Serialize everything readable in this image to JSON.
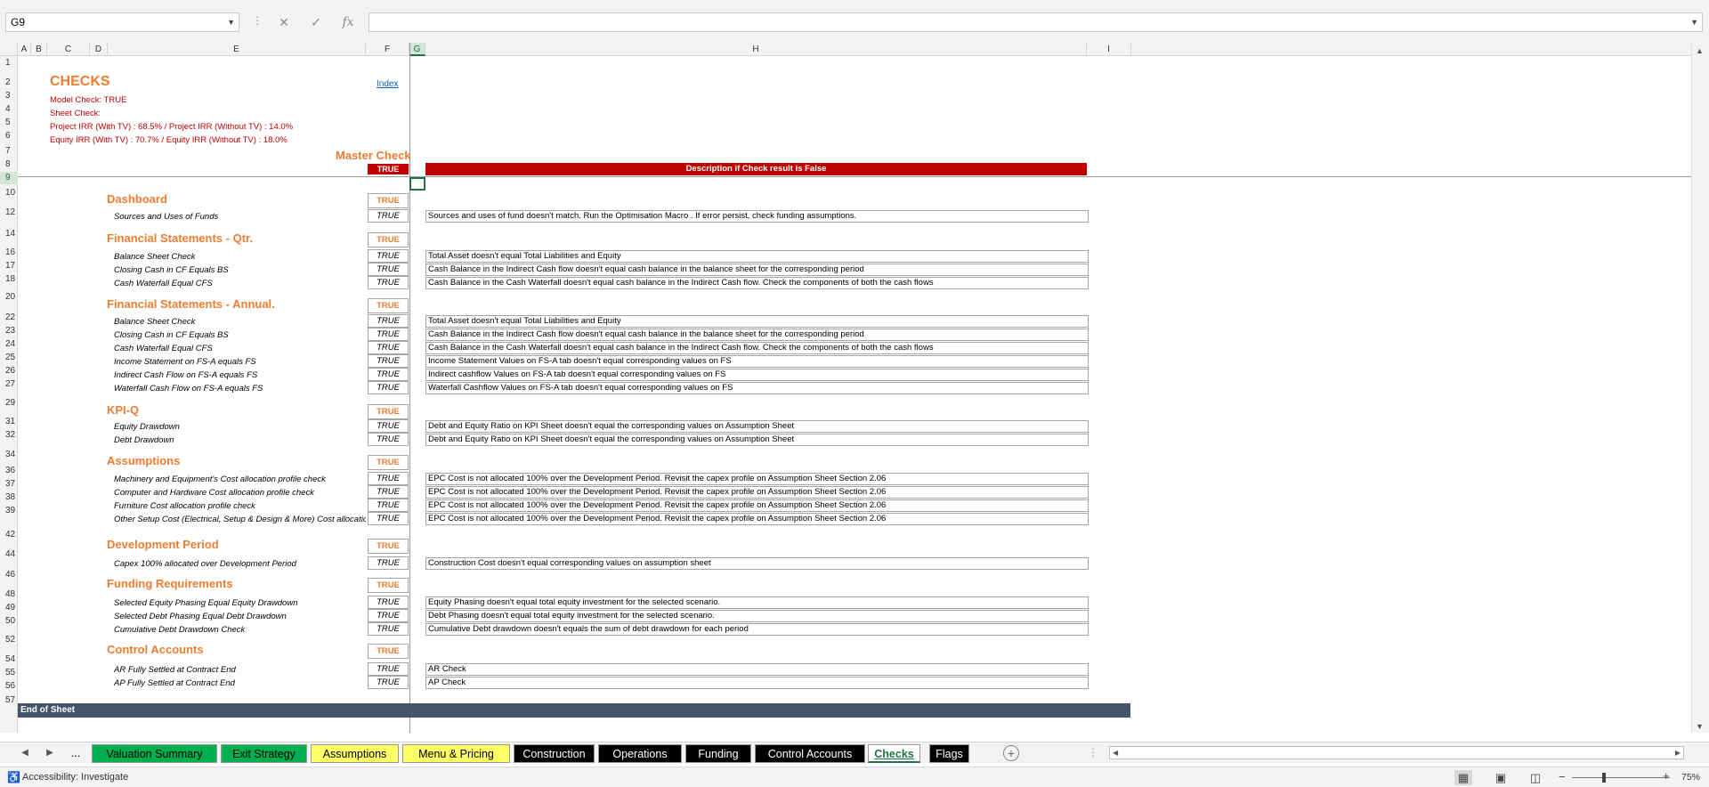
{
  "formula": {
    "name_box": "G9",
    "cancel_symbol": "✕",
    "enter_symbol": "✓",
    "fx_symbol": "fx",
    "formula_value": ""
  },
  "columns": [
    "A",
    "B",
    "C",
    "D",
    "E",
    "F",
    "G",
    "H",
    "I"
  ],
  "rows": [
    "1",
    "2",
    "3",
    "4",
    "5",
    "6",
    "7",
    "8",
    "9",
    "10",
    "12",
    "14",
    "16",
    "17",
    "18",
    "20",
    "22",
    "23",
    "24",
    "25",
    "26",
    "27",
    "29",
    "31",
    "32",
    "34",
    "36",
    "37",
    "38",
    "39",
    "42",
    "44",
    "46",
    "48",
    "49",
    "50",
    "52",
    "54",
    "55",
    "56",
    "57"
  ],
  "sheet": {
    "title": "CHECKS",
    "index_link": "Index",
    "model_check": "Model Check: TRUE",
    "sheet_check": "Sheet Check:",
    "project_irr": "Project IRR  (With TV) : 68.5%  / Project IRR (Without TV) : 14.0%",
    "equity_irr": "Equity IRR  (With TV) : 70.7%  / Equity IRR (Without TV) : 18.0%",
    "master_check_label": "Master Check",
    "master_check_value": "TRUE",
    "desc_header": "Description if Check result is False",
    "end_label": "End of Sheet"
  },
  "sections": [
    {
      "name": "Dashboard",
      "value": "TRUE",
      "items": [
        {
          "label": "Sources and Uses of Funds",
          "value": "TRUE",
          "desc": "Sources and uses of fund doesn't match. Run the Optimisation Macro . If error persist, check funding assumptions."
        }
      ]
    },
    {
      "name": "Financial Statements - Qtr.",
      "value": "TRUE",
      "items": [
        {
          "label": "Balance Sheet Check",
          "value": "TRUE",
          "desc": "Total Asset doesn't equal Total Liabilities and Equity"
        },
        {
          "label": "Closing Cash in CF Equals BS",
          "value": "TRUE",
          "desc": "Cash Balance in the Indirect Cash flow doesn't equal cash balance in the balance sheet for the corresponding period"
        },
        {
          "label": "Cash Waterfall Equal CFS",
          "value": "TRUE",
          "desc": "Cash Balance in the Cash Waterfall doesn't equal cash balance in the Indirect Cash flow. Check the components of both the cash flows"
        }
      ]
    },
    {
      "name": "Financial Statements - Annual.",
      "value": "TRUE",
      "items": [
        {
          "label": "Balance Sheet Check",
          "value": "TRUE",
          "desc": "Total Asset doesn't equal Total Liabilities and Equity"
        },
        {
          "label": "Closing Cash in CF Equals BS",
          "value": "TRUE",
          "desc": "Cash Balance in the Indirect Cash flow doesn't equal cash balance in the balance sheet for the corresponding period"
        },
        {
          "label": "Cash Waterfall Equal CFS",
          "value": "TRUE",
          "desc": "Cash Balance in the Cash Waterfall doesn't equal cash balance in the Indirect Cash flow. Check the components of both the cash flows"
        },
        {
          "label": "Income Statement on FS-A equals FS",
          "value": "TRUE",
          "desc": "Income Statement Values on FS-A tab doesn't equal corresponding values on FS"
        },
        {
          "label": "Indirect Cash Flow on FS-A equals FS",
          "value": "TRUE",
          "desc": "Indirect cashflow Values on FS-A tab doesn't equal corresponding values on FS"
        },
        {
          "label": "Waterfall Cash Flow on FS-A equals FS",
          "value": "TRUE",
          "desc": "Waterfall Cashflow Values on FS-A tab doesn't equal corresponding values on FS"
        }
      ]
    },
    {
      "name": "KPI-Q",
      "value": "TRUE",
      "items": [
        {
          "label": "Equity Drawdown",
          "value": "TRUE",
          "desc": "Debt and Equity Ratio on KPI Sheet doesn't equal the corresponding values on Assumption Sheet"
        },
        {
          "label": "Debt Drawdown",
          "value": "TRUE",
          "desc": "Debt and Equity Ratio on KPI Sheet doesn't equal the corresponding values on Assumption Sheet"
        }
      ]
    },
    {
      "name": "Assumptions",
      "value": "TRUE",
      "items": [
        {
          "label": "Machinery and Equipment's Cost allocation profile check",
          "value": "TRUE",
          "desc": "EPC Cost is not allocated 100% over the Development Period. Revisit the capex profile on Assumption Sheet Section 2.06"
        },
        {
          "label": "Computer and Hardware Cost allocation profile check",
          "value": "TRUE",
          "desc": "EPC Cost is not allocated 100% over the Development Period. Revisit the capex profile on Assumption Sheet Section 2.06"
        },
        {
          "label": "Furniture Cost allocation profile check",
          "value": "TRUE",
          "desc": "EPC Cost is not allocated 100% over the Development Period. Revisit the capex profile on Assumption Sheet Section 2.06"
        },
        {
          "label": "Other Setup Cost (Electrical, Setup & Design & More) Cost allocation profile check",
          "value": "TRUE",
          "desc": "EPC Cost is not allocated 100% over the Development Period. Revisit the capex profile on Assumption Sheet Section 2.06"
        }
      ]
    },
    {
      "name": "Development Period",
      "value": "TRUE",
      "items": [
        {
          "label": "Capex 100% allocated over Development Period",
          "value": "TRUE",
          "desc": "Construction Cost doesn't equal corresponding values on assumption sheet"
        }
      ]
    },
    {
      "name": "Funding Requirements",
      "value": "TRUE",
      "items": [
        {
          "label": "Selected Equity Phasing Equal Equity Drawdown",
          "value": "TRUE",
          "desc": "Equity Phasing doesn't equal total equity investment for the selected scenario."
        },
        {
          "label": "Selected Debt Phasing Equal Debt Drawdown",
          "value": "TRUE",
          "desc": "Debt Phasing doesn't equal total equity investment for the selected scenario."
        },
        {
          "label": "Cumulative Debt Drawdown Check",
          "value": "TRUE",
          "desc": "Cumulative Debt drawdown doesn't equals the sum of debt drawdown for each period"
        }
      ]
    },
    {
      "name": "Control Accounts",
      "value": "TRUE",
      "items": [
        {
          "label": "AR Fully Settled at Contract End",
          "value": "TRUE",
          "desc": "AR Check"
        },
        {
          "label": "AP Fully Settled at Contract End",
          "value": "TRUE",
          "desc": "AP Check"
        }
      ]
    }
  ],
  "tabs": [
    {
      "label": "...",
      "style": "plain"
    },
    {
      "label": "Valuation Summary",
      "style": "green"
    },
    {
      "label": "Exit Strategy",
      "style": "green"
    },
    {
      "label": "Assumptions",
      "style": "yellow"
    },
    {
      "label": "Menu & Pricing",
      "style": "yellow"
    },
    {
      "label": "Construction",
      "style": "black"
    },
    {
      "label": "Operations",
      "style": "black"
    },
    {
      "label": "Funding",
      "style": "black"
    },
    {
      "label": "Control Accounts",
      "style": "black"
    },
    {
      "label": "Checks",
      "style": "active"
    },
    {
      "label": "Flags",
      "style": "black"
    }
  ],
  "colors": {
    "accent_orange": "#ed7d31",
    "alert_red": "#c00000",
    "excel_green": "#217346",
    "end_bar": "#44546a"
  },
  "status": {
    "accessibility": "Accessibility: Investigate",
    "zoom": "75%"
  }
}
